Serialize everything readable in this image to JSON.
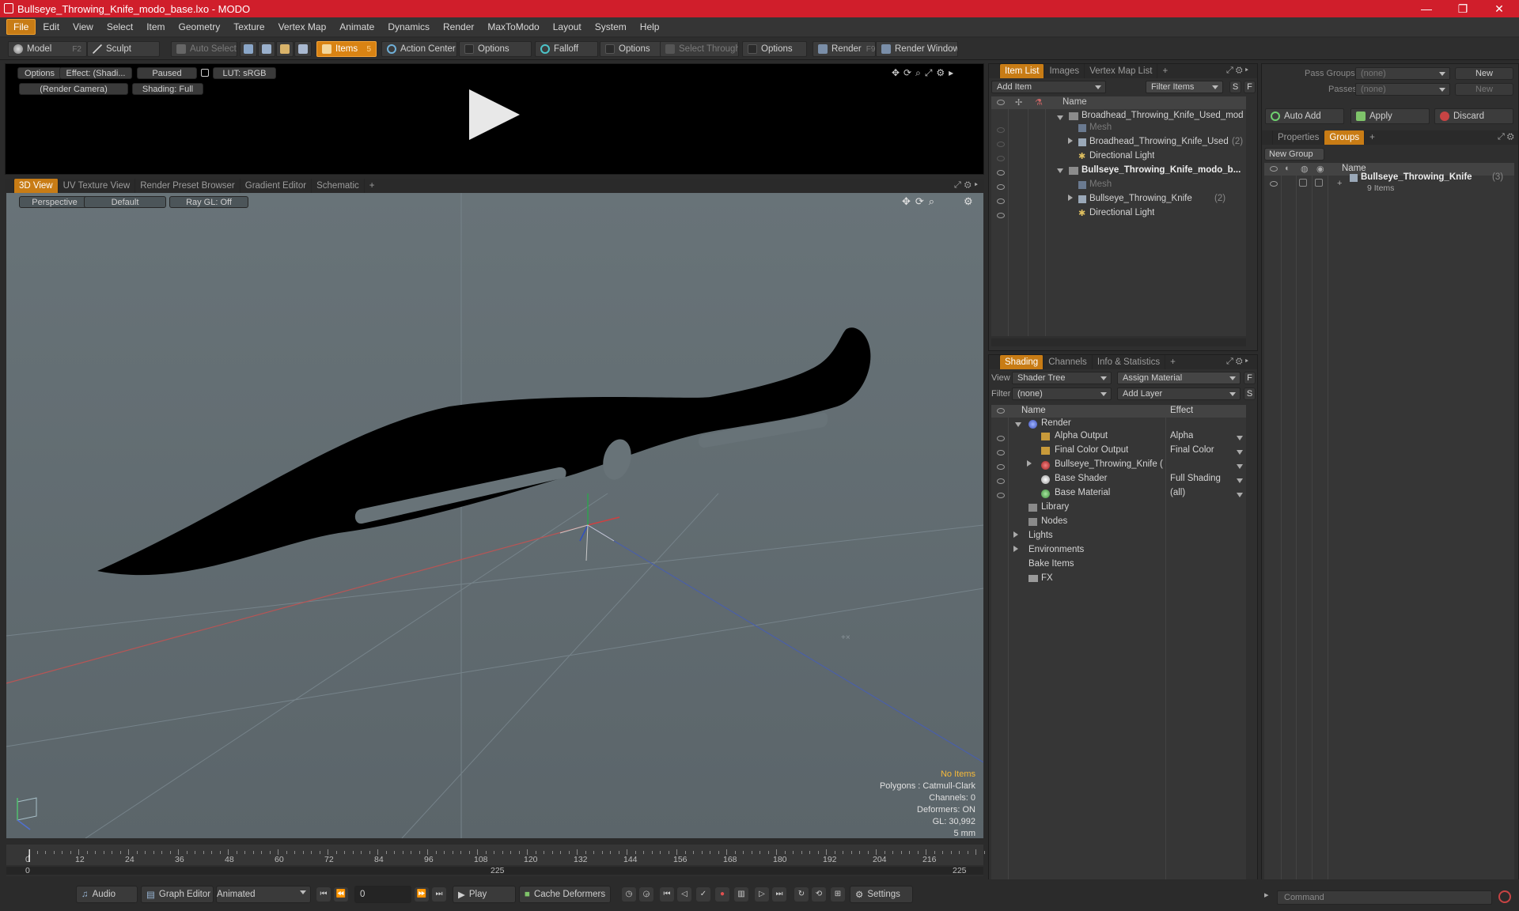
{
  "window": {
    "title": "Bullseye_Throwing_Knife_modo_base.lxo - MODO",
    "min": "—",
    "max": "❐",
    "close": "✕"
  },
  "menu": [
    "File",
    "Edit",
    "View",
    "Select",
    "Item",
    "Geometry",
    "Texture",
    "Vertex Map",
    "Animate",
    "Dynamics",
    "Render",
    "MaxToModo",
    "Layout",
    "System",
    "Help"
  ],
  "toolbar": {
    "model": "Model",
    "model_key": "F2",
    "sculpt": "Sculpt",
    "auto_select": "Auto Select",
    "items": "Items",
    "items_key": "5",
    "action_center": "Action Center",
    "options1": "Options",
    "falloff": "Falloff",
    "options2": "Options",
    "select_through": "Select Through",
    "options3": "Options",
    "render": "Render",
    "render_key": "F9",
    "render_window": "Render Window"
  },
  "preview": {
    "options": "Options",
    "effect": "Effect: (Shadi...",
    "paused": "Paused",
    "lut": "LUT: sRGB",
    "camera": "(Render Camera)",
    "shading": "Shading: Full"
  },
  "viewtabs": [
    "3D View",
    "UV Texture View",
    "Render Preset Browser",
    "Gradient Editor",
    "Schematic",
    "+"
  ],
  "viewport": {
    "perspective": "Perspective",
    "default": "Default",
    "raygl": "Ray GL: Off",
    "hud": {
      "no_items": "No Items",
      "polygons": "Polygons : Catmull-Clark",
      "channels": "Channels: 0",
      "deformers": "Deformers: ON",
      "gl": "GL: 30,992",
      "unit": "5 mm"
    }
  },
  "itemlist": {
    "tabs": [
      "Item List",
      "Images",
      "Vertex Map List",
      "+"
    ],
    "add_item": "Add Item",
    "filter": "Filter Items",
    "s": "S",
    "f": "F",
    "col_name": "Name",
    "rows": [
      {
        "label": "Broadhead_Throwing_Knife_Used_modo...",
        "bold": false
      },
      {
        "label": "Mesh",
        "bold": false
      },
      {
        "label": "Broadhead_Throwing_Knife_Used",
        "count": "(2)",
        "bold": false
      },
      {
        "label": "Directional Light",
        "bold": false
      },
      {
        "label": "Bullseye_Throwing_Knife_modo_b...",
        "bold": true
      },
      {
        "label": "Mesh",
        "bold": false
      },
      {
        "label": "Bullseye_Throwing_Knife",
        "count": "(2)",
        "bold": false
      },
      {
        "label": "Directional Light",
        "bold": false
      }
    ]
  },
  "shading": {
    "tabs": [
      "Shading",
      "Channels",
      "Info & Statistics",
      "+"
    ],
    "view_label": "View",
    "view_value": "Shader Tree",
    "assign_material": "Assign Material",
    "filter_label": "Filter",
    "filter_value": "(none)",
    "add_layer": "Add Layer",
    "f": "F",
    "s": "S",
    "col_name": "Name",
    "col_effect": "Effect",
    "rows": [
      {
        "label": "Render",
        "effect": ""
      },
      {
        "label": "Alpha Output",
        "effect": "Alpha"
      },
      {
        "label": "Final Color Output",
        "effect": "Final Color"
      },
      {
        "label": "Bullseye_Throwing_Knife ( ...",
        "effect": ""
      },
      {
        "label": "Base Shader",
        "effect": "Full Shading"
      },
      {
        "label": "Base Material",
        "effect": "(all)"
      },
      {
        "label": "Library",
        "effect": ""
      },
      {
        "label": "Nodes",
        "effect": ""
      },
      {
        "label": "Lights",
        "effect": ""
      },
      {
        "label": "Environments",
        "effect": ""
      },
      {
        "label": "Bake Items",
        "effect": ""
      },
      {
        "label": "FX",
        "effect": ""
      }
    ]
  },
  "groups": {
    "pass_groups": "Pass Groups",
    "passes": "Passes",
    "none1": "(none)",
    "none2": "(none)",
    "new1": "New",
    "new2": "New",
    "auto_add": "Auto Add",
    "apply": "Apply",
    "discard": "Discard",
    "tabs": [
      "Properties",
      "Groups",
      "+"
    ],
    "new_group": "New Group",
    "col_name": "Name",
    "group_name": "Bullseye_Throwing_Knife",
    "group_count": "(3)",
    "group_items": "9 Items"
  },
  "timeline": {
    "labels": [
      "0",
      "12",
      "24",
      "36",
      "48",
      "60",
      "72",
      "84",
      "96",
      "108",
      "120",
      "132",
      "144",
      "156",
      "168",
      "180",
      "192",
      "204",
      "216"
    ],
    "range_start": "0",
    "range_mid": "225",
    "range_end": "225"
  },
  "bottom": {
    "audio": "Audio",
    "graph_editor": "Graph Editor",
    "animated": "Animated",
    "frame": "0",
    "play": "Play",
    "cache_deformers": "Cache Deformers",
    "settings": "Settings",
    "command": "Command"
  }
}
